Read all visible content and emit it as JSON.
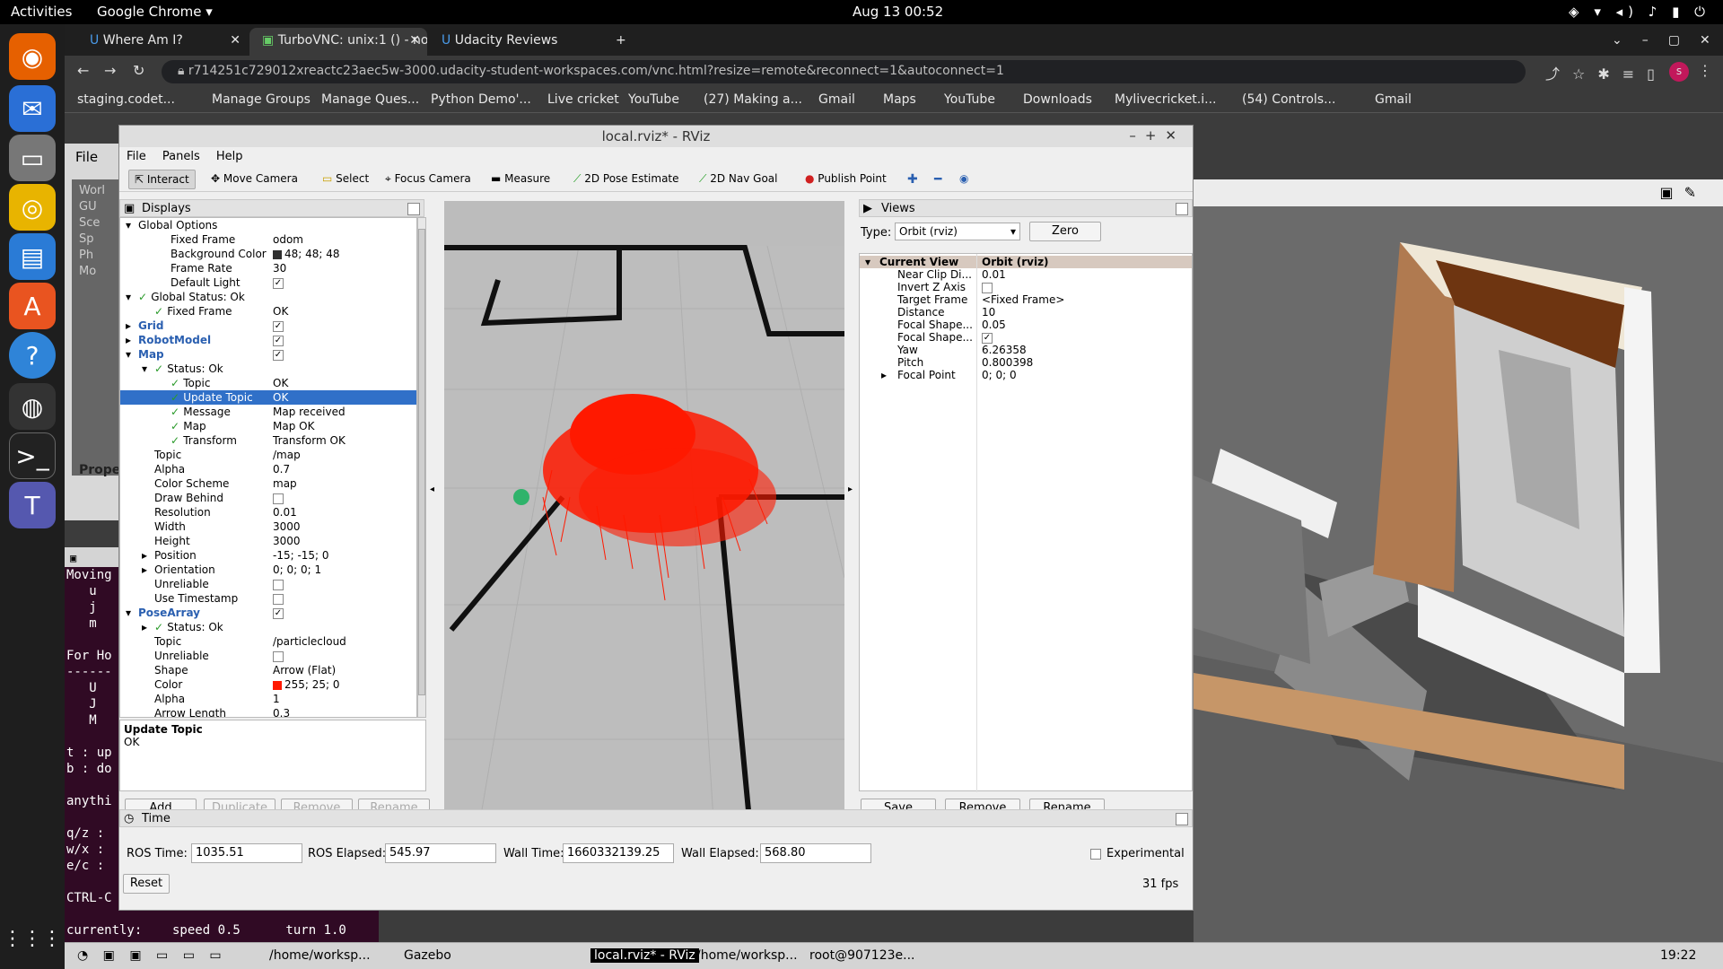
{
  "topbar": {
    "activities": "Activities",
    "app": "Google Chrome ▾",
    "clock": "Aug 13  00:52"
  },
  "chrome": {
    "tabs": [
      {
        "label": "Where Am I?"
      },
      {
        "label": "TurboVNC: unix:1 () - noV"
      },
      {
        "label": "Udacity Reviews"
      }
    ],
    "url": "r714251c729012xreactc23aec5w-3000.udacity-student-workspaces.com/vnc.html?resize=remote&reconnect=1&autoconnect=1",
    "bookmarks": [
      "staging.codet...",
      "Manage Groups",
      "Manage Ques...",
      "Python Demo'...",
      "Live cricket",
      "YouTube",
      "(27) Making a...",
      "Gmail",
      "Maps",
      "YouTube",
      "Downloads",
      "Mylivecricket.i...",
      "(54) Controls...",
      "Gmail"
    ]
  },
  "rviz": {
    "title": "local.rviz* - RViz",
    "menu": [
      "File",
      "Panels",
      "Help"
    ],
    "tools": [
      "Interact",
      "Move Camera",
      "Select",
      "Focus Camera",
      "Measure",
      "2D Pose Estimate",
      "2D Nav Goal",
      "Publish Point"
    ],
    "displays_title": "Displays",
    "rows": [
      {
        "k": "Global Options",
        "v": "",
        "i": 0,
        "exp": "▾",
        "cls": ""
      },
      {
        "k": "Fixed Frame",
        "v": "odom",
        "i": 2,
        "exp": "",
        "cls": ""
      },
      {
        "k": "Background Color",
        "v": "48; 48; 48",
        "i": 2,
        "exp": "",
        "cls": "",
        "sw": "#303030"
      },
      {
        "k": "Frame Rate",
        "v": "30",
        "i": 2,
        "exp": "",
        "cls": ""
      },
      {
        "k": "Default Light",
        "v": "✓",
        "i": 2,
        "exp": "",
        "cls": "",
        "box": true
      },
      {
        "k": "Global Status: Ok",
        "v": "",
        "i": 0,
        "exp": "▾",
        "cls": "",
        "ok": true
      },
      {
        "k": "Fixed Frame",
        "v": "OK",
        "i": 1,
        "exp": "",
        "cls": "",
        "ok": true
      },
      {
        "k": "Grid",
        "v": "✓",
        "i": 0,
        "exp": "▸",
        "cls": "blue",
        "box": true
      },
      {
        "k": "RobotModel",
        "v": "✓",
        "i": 0,
        "exp": "▸",
        "cls": "blue",
        "box": true
      },
      {
        "k": "Map",
        "v": "✓",
        "i": 0,
        "exp": "▾",
        "cls": "blue",
        "box": true
      },
      {
        "k": "Status: Ok",
        "v": "",
        "i": 1,
        "exp": "▾",
        "cls": "",
        "ok": true
      },
      {
        "k": "Topic",
        "v": "OK",
        "i": 2,
        "exp": "",
        "cls": "",
        "ok": true
      },
      {
        "k": "Update Topic",
        "v": "OK",
        "i": 2,
        "exp": "",
        "cls": "",
        "ok": true,
        "sel": true
      },
      {
        "k": "Message",
        "v": "Map received",
        "i": 2,
        "exp": "",
        "cls": "",
        "ok": true
      },
      {
        "k": "Map",
        "v": "Map OK",
        "i": 2,
        "exp": "",
        "cls": "",
        "ok": true
      },
      {
        "k": "Transform",
        "v": "Transform OK",
        "i": 2,
        "exp": "",
        "cls": "",
        "ok": true
      },
      {
        "k": "Topic",
        "v": "/map",
        "i": 1,
        "exp": "",
        "cls": ""
      },
      {
        "k": "Alpha",
        "v": "0.7",
        "i": 1,
        "exp": "",
        "cls": ""
      },
      {
        "k": "Color Scheme",
        "v": "map",
        "i": 1,
        "exp": "",
        "cls": ""
      },
      {
        "k": "Draw Behind",
        "v": "",
        "i": 1,
        "exp": "",
        "cls": "",
        "box": true
      },
      {
        "k": "Resolution",
        "v": "0.01",
        "i": 1,
        "exp": "",
        "cls": ""
      },
      {
        "k": "Width",
        "v": "3000",
        "i": 1,
        "exp": "",
        "cls": ""
      },
      {
        "k": "Height",
        "v": "3000",
        "i": 1,
        "exp": "",
        "cls": ""
      },
      {
        "k": "Position",
        "v": "-15; -15; 0",
        "i": 1,
        "exp": "▸",
        "cls": ""
      },
      {
        "k": "Orientation",
        "v": "0; 0; 0; 1",
        "i": 1,
        "exp": "▸",
        "cls": ""
      },
      {
        "k": "Unreliable",
        "v": "",
        "i": 1,
        "exp": "",
        "cls": "",
        "box": true
      },
      {
        "k": "Use Timestamp",
        "v": "",
        "i": 1,
        "exp": "",
        "cls": "",
        "box": true
      },
      {
        "k": "PoseArray",
        "v": "✓",
        "i": 0,
        "exp": "▾",
        "cls": "blue",
        "box": true
      },
      {
        "k": "Status: Ok",
        "v": "",
        "i": 1,
        "exp": "▸",
        "cls": "",
        "ok": true
      },
      {
        "k": "Topic",
        "v": "/particlecloud",
        "i": 1,
        "exp": "",
        "cls": ""
      },
      {
        "k": "Unreliable",
        "v": "",
        "i": 1,
        "exp": "",
        "cls": "",
        "box": true
      },
      {
        "k": "Shape",
        "v": "Arrow (Flat)",
        "i": 1,
        "exp": "",
        "cls": ""
      },
      {
        "k": "Color",
        "v": "255; 25; 0",
        "i": 1,
        "exp": "",
        "cls": "",
        "sw": "#ff1900"
      },
      {
        "k": "Alpha",
        "v": "1",
        "i": 1,
        "exp": "",
        "cls": ""
      },
      {
        "k": "Arrow Length",
        "v": "0.3",
        "i": 1,
        "exp": "",
        "cls": ""
      }
    ],
    "desc_title": "Update Topic",
    "desc_value": "OK",
    "disp_buttons": [
      "Add",
      "Duplicate",
      "Remove",
      "Rename"
    ],
    "views_title": "Views",
    "type_label": "Type:",
    "type_value": "Orbit (rviz)",
    "zero": "Zero",
    "view_rows": [
      {
        "k": "Current View",
        "v": "Orbit (rviz)",
        "head": true
      },
      {
        "k": "Near Clip Di...",
        "v": "0.01"
      },
      {
        "k": "Invert Z Axis",
        "v": "",
        "box": true
      },
      {
        "k": "Target Frame",
        "v": "<Fixed Frame>"
      },
      {
        "k": "Distance",
        "v": "10"
      },
      {
        "k": "Focal Shape...",
        "v": "0.05"
      },
      {
        "k": "Focal Shape...",
        "v": "✓",
        "box": true
      },
      {
        "k": "Yaw",
        "v": "6.26358"
      },
      {
        "k": "Pitch",
        "v": "0.800398"
      },
      {
        "k": "Focal Point",
        "v": "0; 0; 0",
        "exp": "▸"
      }
    ],
    "view_buttons": [
      "Save",
      "Remove",
      "Rename"
    ],
    "time_title": "Time",
    "ros_time_label": "ROS Time:",
    "ros_time": "1035.51",
    "ros_elapsed_label": "ROS Elapsed:",
    "ros_elapsed": "545.97",
    "wall_time_label": "Wall Time:",
    "wall_time": "1660332139.25",
    "wall_elapsed_label": "Wall Elapsed:",
    "wall_elapsed": "568.80",
    "experimental": "Experimental",
    "reset": "Reset",
    "fps": "31 fps"
  },
  "gazebo_side": {
    "file": "File",
    "items": [
      "Worl",
      "GU",
      "Sce",
      "Sp",
      "Ph",
      "Mo"
    ],
    "prope": "Prope"
  },
  "terminal": {
    "lines": [
      "Moving",
      "   u",
      "   j",
      "   m",
      "",
      "For Ho",
      "------",
      "   U",
      "   J",
      "   M",
      "",
      "t : up",
      "b : do",
      "",
      "anythi",
      "",
      "q/z :",
      "w/x :",
      "e/c :",
      "",
      "CTRL-C",
      "",
      "currently:    speed 0.5      turn 1.0"
    ]
  },
  "taskbar": {
    "items": [
      "/home/worksp...",
      "Gazebo",
      "local.rviz* - RViz",
      "/home/worksp...",
      "root@907123e..."
    ],
    "time": "19:22"
  }
}
